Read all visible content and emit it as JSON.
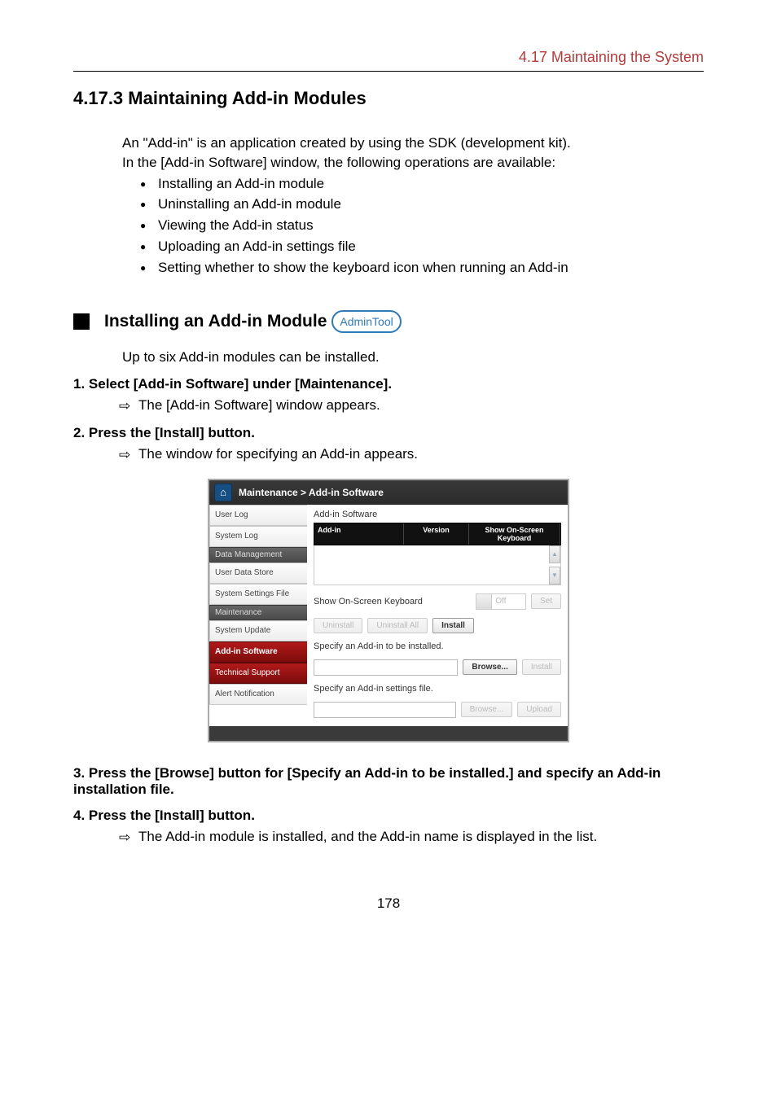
{
  "header": {
    "crumb": "4.17 Maintaining the System"
  },
  "title": "4.17.3 Maintaining Add-in Modules",
  "intro": {
    "line1": "An \"Add-in\" is an application created by using the SDK (development kit).",
    "line2": "In the [Add-in Software] window, the following operations are available:"
  },
  "bullets": {
    "b1": "Installing an Add-in module",
    "b2": "Uninstalling an Add-in module",
    "b3": "Viewing the Add-in status",
    "b4": "Uploading an Add-in settings file",
    "b5": "Setting whether to show the keyboard icon when running an Add-in"
  },
  "subheading": {
    "text": "Installing an Add-in Module",
    "tag": "AdminTool"
  },
  "pre_steps_text": "Up to six Add-in modules can be installed.",
  "steps": {
    "s1": {
      "title": "1.   Select [Add-in Software] under [Maintenance].",
      "result": "The [Add-in Software] window appears."
    },
    "s2": {
      "title": "2.   Press the [Install] button.",
      "result": "The window for specifying an Add-in appears."
    },
    "s3": {
      "title": "3.   Press the [Browse] button for [Specify an Add-in to be installed.] and specify an Add-in installation file."
    },
    "s4": {
      "title": "4.   Press the [Install] button.",
      "result": "The Add-in module is installed, and the Add-in name is displayed in the list."
    }
  },
  "screenshot": {
    "breadcrumb": "Maintenance > Add-in Software",
    "nav": {
      "user_log": "User Log",
      "system_log": "System Log",
      "data_mgmt_head": "Data Management",
      "user_data_store": "User Data Store",
      "system_settings_file": "System Settings File",
      "maintenance_head": "Maintenance",
      "system_update": "System Update",
      "addin_software": "Add-in Software",
      "technical_support": "Technical Support",
      "alert_notification": "Alert Notification"
    },
    "main": {
      "panel_title": "Add-in Software",
      "th_addin": "Add-in",
      "th_version": "Version",
      "th_show": "Show On-Screen Keyboard",
      "row_show_label": "Show On-Screen Keyboard",
      "row_show_state": "Off",
      "btn_set": "Set",
      "btn_uninstall": "Uninstall",
      "btn_uninstall_all": "Uninstall All",
      "btn_install": "Install",
      "spec_install_label": "Specify an Add-in to be installed.",
      "btn_browse1": "Browse...",
      "btn_install2": "Install",
      "spec_settings_label": "Specify an Add-in settings file.",
      "btn_browse2": "Browse...",
      "btn_upload": "Upload"
    }
  },
  "page_number": "178"
}
